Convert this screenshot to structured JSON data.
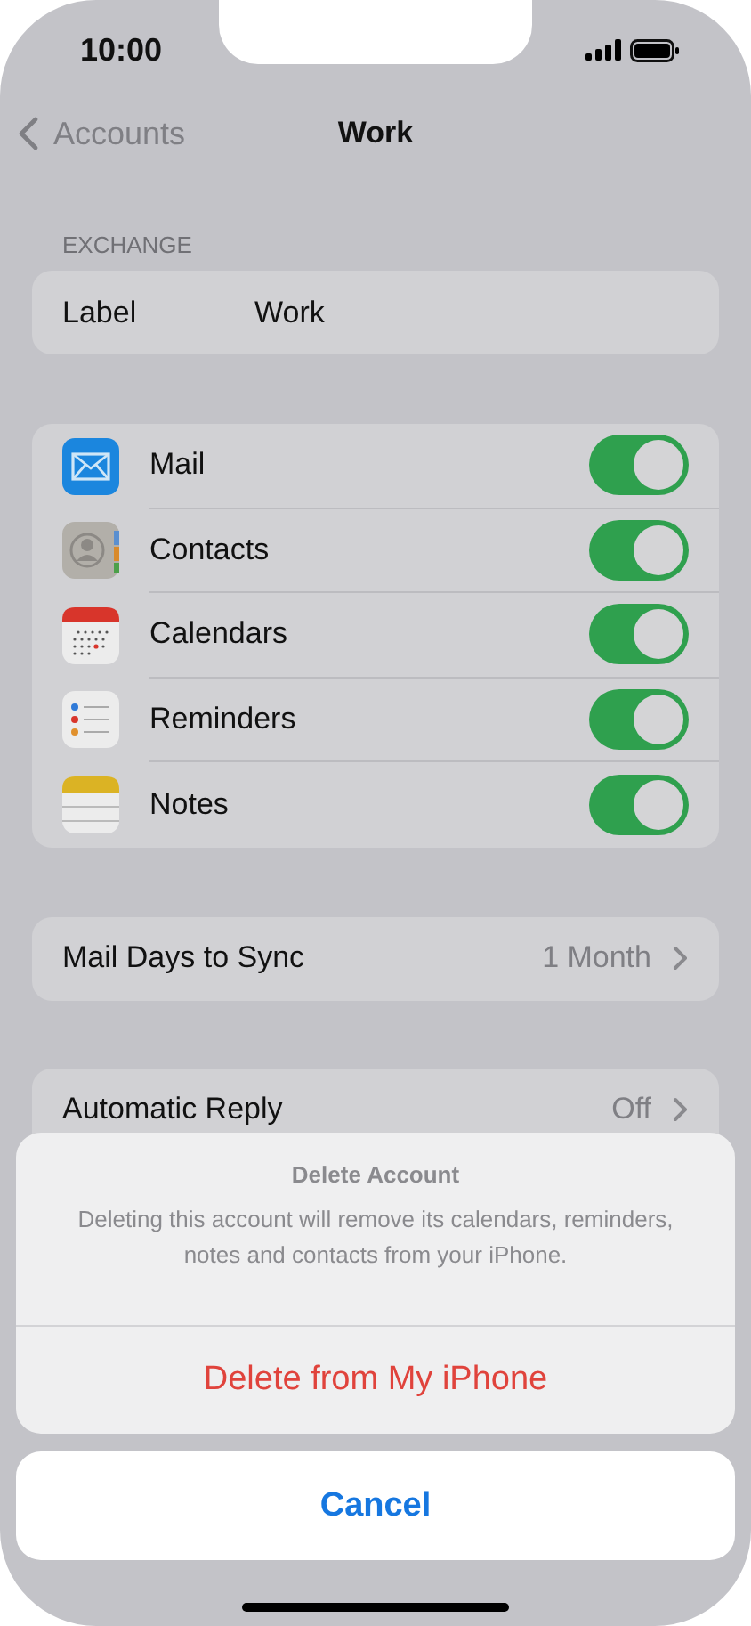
{
  "status_bar": {
    "time": "10:00"
  },
  "nav": {
    "back": "Accounts",
    "title": "Work"
  },
  "section_header": "EXCHANGE",
  "label_row": {
    "label": "Label",
    "value": "Work"
  },
  "services": [
    {
      "kind": "mail",
      "label": "Mail",
      "on": true
    },
    {
      "kind": "contacts",
      "label": "Contacts",
      "on": true
    },
    {
      "kind": "calendars",
      "label": "Calendars",
      "on": true
    },
    {
      "kind": "reminders",
      "label": "Reminders",
      "on": true
    },
    {
      "kind": "notes",
      "label": "Notes",
      "on": true
    }
  ],
  "sync_row": {
    "label": "Mail Days to Sync",
    "value": "1 Month"
  },
  "reply_row": {
    "label": "Automatic Reply",
    "value": "Off"
  },
  "action_sheet": {
    "title": "Delete Account",
    "message": "Deleting this account will remove its calendars, reminders, notes and contacts from your iPhone.",
    "actions": [
      {
        "label": "Delete from My iPhone",
        "kind": "destructive"
      }
    ],
    "cancel": "Cancel"
  }
}
